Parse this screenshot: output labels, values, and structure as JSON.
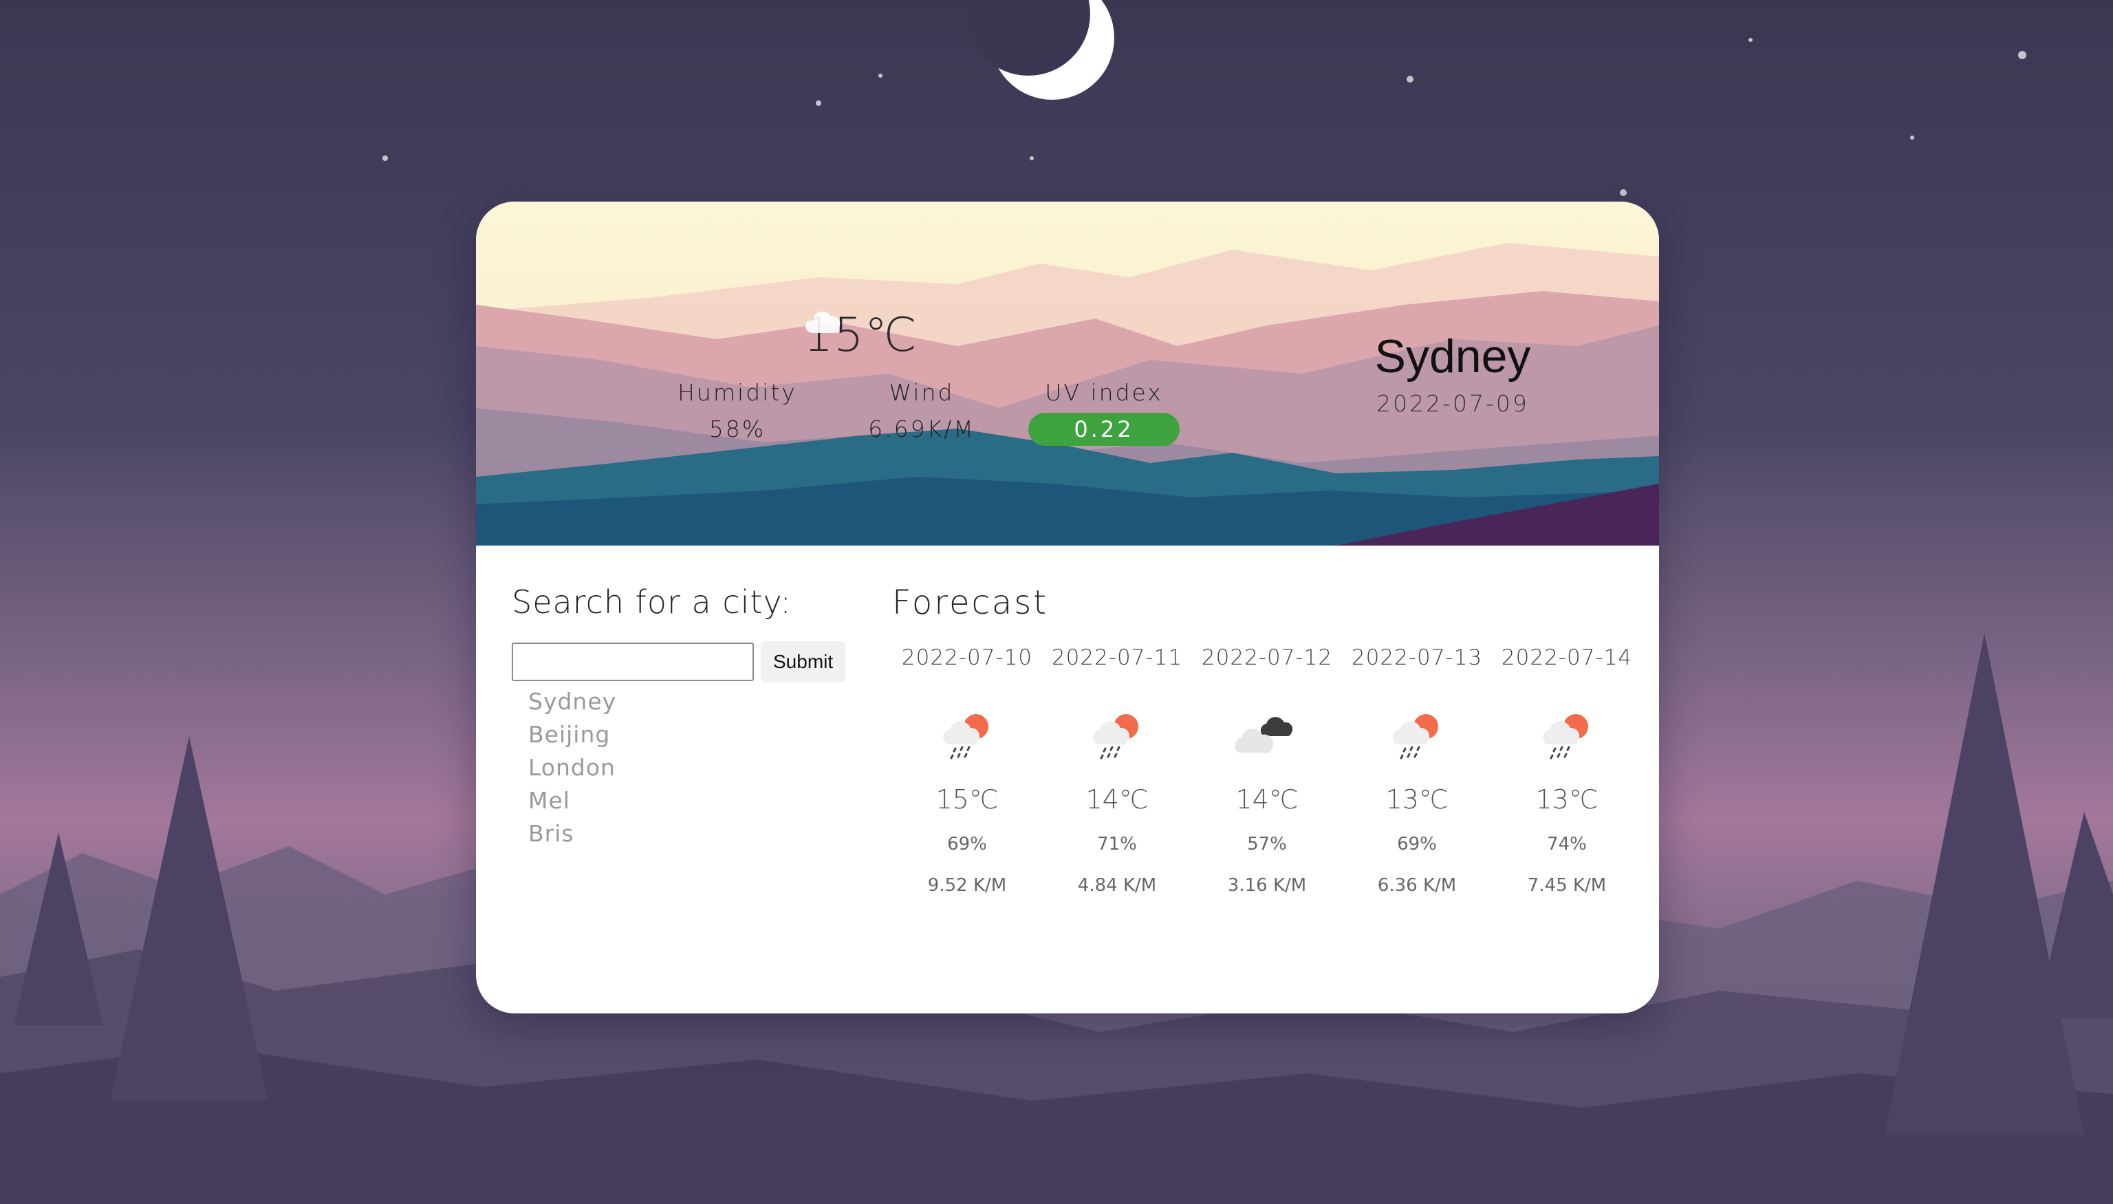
{
  "current": {
    "temperature": "15℃",
    "condition_icon": "cloud-icon",
    "humidity_label": "Humidity",
    "humidity_value": "58%",
    "wind_label": "Wind",
    "wind_value": "6.69K/M",
    "uv_label": "UV index",
    "uv_value": "0.22",
    "uv_color": "#3ea33f"
  },
  "location": {
    "city": "Sydney",
    "date": "2022-07-09"
  },
  "search": {
    "title": "Search for a city:",
    "input_value": "",
    "submit_label": "Submit",
    "cities": [
      "Sydney",
      "Beijing",
      "London",
      "Mel",
      "Bris"
    ]
  },
  "forecast": {
    "title": "Forecast",
    "days": [
      {
        "date": "2022-07-10",
        "icon": "rain-sun-icon",
        "temp": "15℃",
        "humidity": "69%",
        "wind": "9.52 K/M"
      },
      {
        "date": "2022-07-11",
        "icon": "rain-sun-icon",
        "temp": "14℃",
        "humidity": "71%",
        "wind": "4.84 K/M"
      },
      {
        "date": "2022-07-12",
        "icon": "overcast-icon",
        "temp": "14℃",
        "humidity": "57%",
        "wind": "3.16 K/M"
      },
      {
        "date": "2022-07-13",
        "icon": "rain-sun-icon",
        "temp": "13℃",
        "humidity": "69%",
        "wind": "6.36 K/M"
      },
      {
        "date": "2022-07-14",
        "icon": "rain-sun-icon",
        "temp": "13℃",
        "humidity": "74%",
        "wind": "7.45 K/M"
      }
    ]
  }
}
